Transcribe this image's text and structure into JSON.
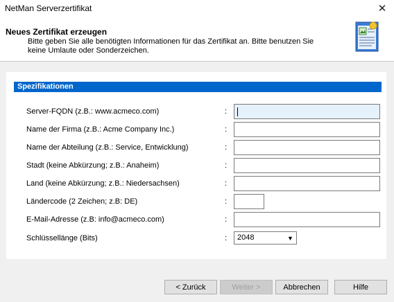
{
  "window": {
    "title": "NetMan Serverzertifikat",
    "close_glyph": "✕"
  },
  "header": {
    "title": "Neues Zertifikat erzeugen",
    "description": "Bitte geben Sie alle benötigten Informationen für das Zertifikat an. Bitte benutzen Sie keine Umlaute oder Sonderzeichen.",
    "icon": "certificate-wizard-icon"
  },
  "section": {
    "title": "Spezifikationen"
  },
  "fields": [
    {
      "label": "Server-FQDN (z.B.: www.acmeco.com)",
      "colon": ":",
      "value": "",
      "focused": true
    },
    {
      "label": "Name der Firma (z.B.: Acme Company Inc.)",
      "colon": ":",
      "value": ""
    },
    {
      "label": "Name der Abteilung (z.B.: Service, Entwicklung)",
      "colon": ":",
      "value": ""
    },
    {
      "label": "Stadt (keine Abkürzung; z.B.: Anaheim)",
      "colon": ":",
      "value": ""
    },
    {
      "label": "Land (keine Abkürzung; z.B.: Niedersachsen)",
      "colon": ":",
      "value": ""
    },
    {
      "label": "Ländercode (2 Zeichen; z.B: DE)",
      "colon": ":",
      "value": ""
    },
    {
      "label": "E-Mail-Adresse (z.B: info@acmeco.com)",
      "colon": ":",
      "value": ""
    }
  ],
  "keylength": {
    "label": "Schlüssellänge (Bits)",
    "colon": ":",
    "selected": "2048"
  },
  "buttons": {
    "back": "< Zurück",
    "next": "Weiter >",
    "cancel": "Abbrechen",
    "help": "Hilfe"
  },
  "colors": {
    "section_bar": "#0066cc",
    "dialog_bg": "#f0f0f0"
  }
}
